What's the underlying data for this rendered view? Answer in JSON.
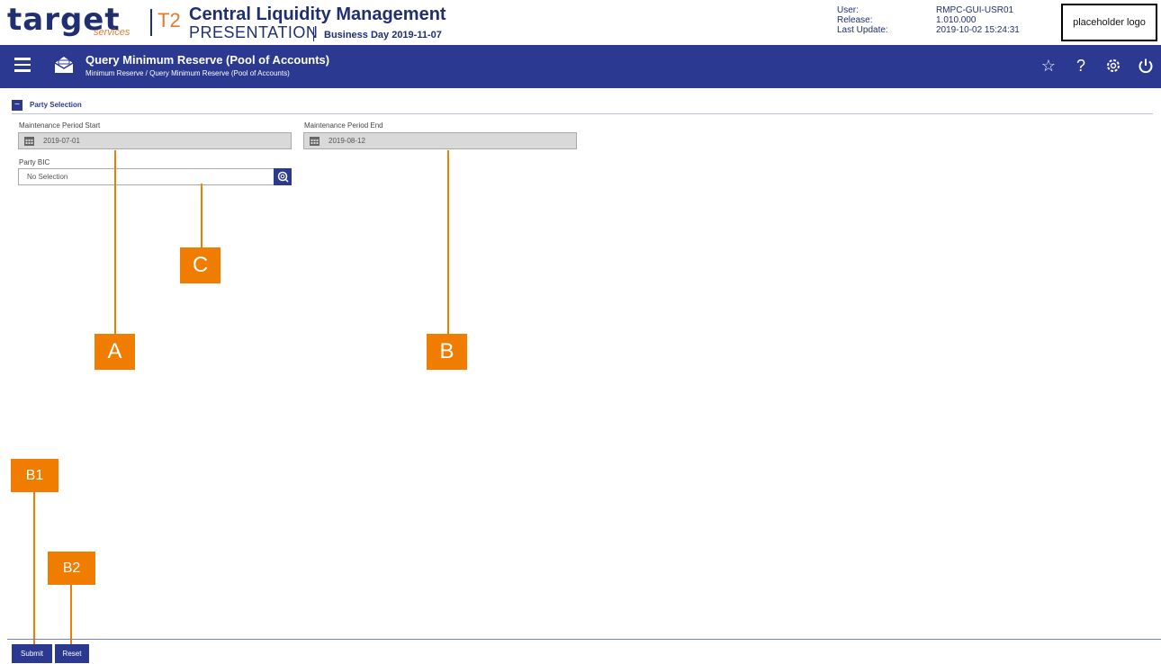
{
  "header": {
    "logo_target": "target",
    "logo_services": "services",
    "t2": "T2",
    "app_title": "Central Liquidity Management",
    "environment": "PRESENTATION",
    "business_day": "Business Day 2019-11-07",
    "user_label": "User:",
    "release_label": "Release:",
    "last_update_label": "Last Update:",
    "user_value": "RMPC-GUI-USR01",
    "release_value": "1.010.000",
    "last_update_value": "2019-10-02 15:24:31",
    "placeholder_logo": "placeholder logo"
  },
  "nav": {
    "title": "Query Minimum Reserve (Pool of Accounts)",
    "breadcrumb": "Minimum Reserve  /  Query Minimum Reserve (Pool of Accounts)",
    "icons": [
      "star-icon",
      "help-icon",
      "settings-icon",
      "power-icon"
    ]
  },
  "form": {
    "section_toggle": "−",
    "section_title": "Party Selection",
    "period_start_label": "Maintenance Period Start",
    "period_start_value": "2019-07-01",
    "period_end_label": "Maintenance Period End",
    "period_end_value": "2019-08-12",
    "party_bic_label": "Party BIC",
    "party_bic_value": "No Selection"
  },
  "callouts": {
    "a": "A",
    "b": "B",
    "c": "C",
    "b1": "B1",
    "b2": "B2"
  },
  "footer": {
    "submit_label": "Submit",
    "reset_label": "Reset"
  },
  "colors": {
    "primary": "#2b3990",
    "accent": "#f07c00",
    "brand_orange": "#e07b2a"
  }
}
